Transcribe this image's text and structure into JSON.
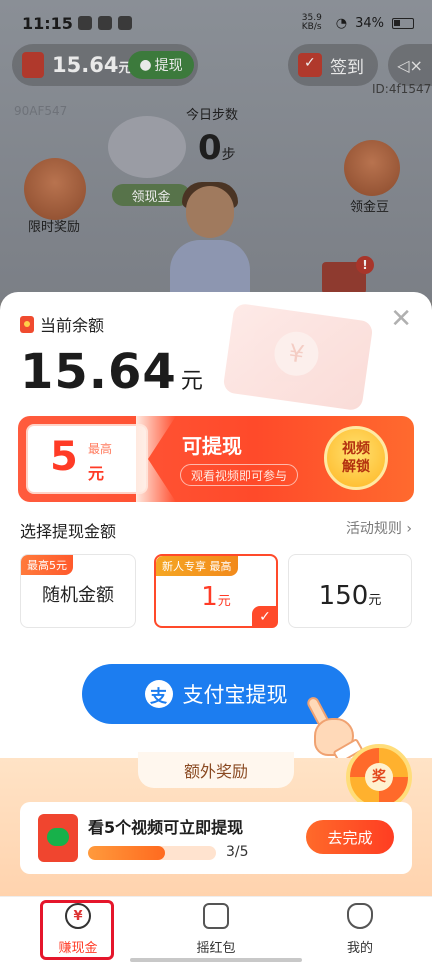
{
  "status_bar": {
    "time": "11:15",
    "net_speed": "35.9 KB/s",
    "battery": "34%"
  },
  "background": {
    "balance_amount": "15.64",
    "balance_unit": "元",
    "withdraw_label": "提现",
    "sign_in_label": "签到",
    "user_id": "ID:4f1547",
    "faint_id": "90AF547",
    "steps_label": "今日步数",
    "steps_value": "0",
    "steps_unit": "步",
    "collect_cash_label": "领现金",
    "time_reward_label": "限时奖励",
    "collect_beans_label": "领金豆",
    "alert_badge": "!"
  },
  "sheet": {
    "balance_title": "当前余额",
    "balance_value": "15.64",
    "balance_unit": "元",
    "close_icon": "close-icon",
    "promo": {
      "coupon_value": "5",
      "coupon_max": "最高",
      "coupon_unit": "元",
      "title": "可提现",
      "subtitle": "观看视频即可参与",
      "unlock_line1": "视频",
      "unlock_line2": "解锁"
    },
    "choose_label": "选择提现金额",
    "rules_label": "活动规则 ›",
    "options": [
      {
        "tag": "最高5元",
        "label": "随机金额",
        "selected": false
      },
      {
        "tag": "新人专享 最高",
        "value": "1",
        "unit": "元",
        "selected": true
      },
      {
        "value": "150",
        "unit": "元",
        "selected": false
      }
    ],
    "alipay_logo": "支",
    "alipay_label": "支付宝提现",
    "bonus": {
      "title": "额外奖励",
      "wheel_label": "奖",
      "task_title": "看5个视频可立即提现",
      "progress_text": "3/5",
      "progress_fraction": 0.6,
      "task_button": "去完成"
    }
  },
  "tabbar": {
    "items": [
      {
        "label": "赚现金",
        "icon": "yuan-coin-icon",
        "glyph": "¥",
        "active": true
      },
      {
        "label": "摇红包",
        "icon": "red-packet-box-icon",
        "active": false
      },
      {
        "label": "我的",
        "icon": "profile-face-icon",
        "active": false
      }
    ]
  },
  "colors": {
    "accent_red": "#ff3b26",
    "alipay_blue": "#1c7df0",
    "highlight_frame": "#e5162b"
  }
}
